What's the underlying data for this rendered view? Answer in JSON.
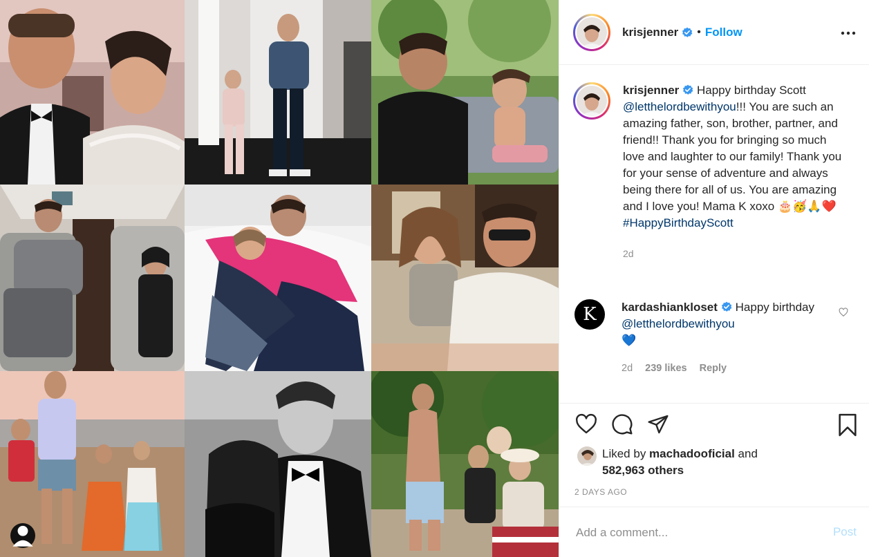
{
  "post": {
    "author": "krisjenner",
    "follow_label": "Follow",
    "dot": "•"
  },
  "caption": {
    "username": "krisjenner",
    "text_1": "Happy birthday Scott ",
    "mention": "@letthelordbewithyou",
    "text_2": "!!! You are such an amazing father, son, brother, partner, and friend!! Thank you for bringing so much love and laughter to our family! Thank you for your sense of adventure and always being there for all of us. You are amazing and I love you! Mama K xoxo ",
    "emojis": "🎂🥳🙏❤️",
    "hashtag": "#HappyBirthdayScott",
    "timestamp": "2d"
  },
  "comments": [
    {
      "username": "kardashiankloset",
      "avatar_letter": "K",
      "text_1": "Happy birthday ",
      "mention": "@letthelordbewithyou",
      "emoji": "💙",
      "timestamp": "2d",
      "likes": "239 likes",
      "reply_label": "Reply"
    }
  ],
  "actions": {
    "like_icon": "heart-outline-icon",
    "comment_icon": "comment-bubble-icon",
    "share_icon": "paper-plane-icon",
    "save_icon": "bookmark-icon"
  },
  "likes": {
    "prefix": "Liked by ",
    "liker": "machadooficial",
    "middle": " and",
    "others": "582,963 others"
  },
  "posted_ago": "2 DAYS AGO",
  "comment_box": {
    "placeholder": "Add a comment...",
    "post_label": "Post"
  },
  "colors": {
    "link": "#00376b",
    "follow": "#0095f6",
    "post_disabled": "#b2dffc",
    "muted": "#8e8e8e",
    "verified": "#3897f0"
  }
}
